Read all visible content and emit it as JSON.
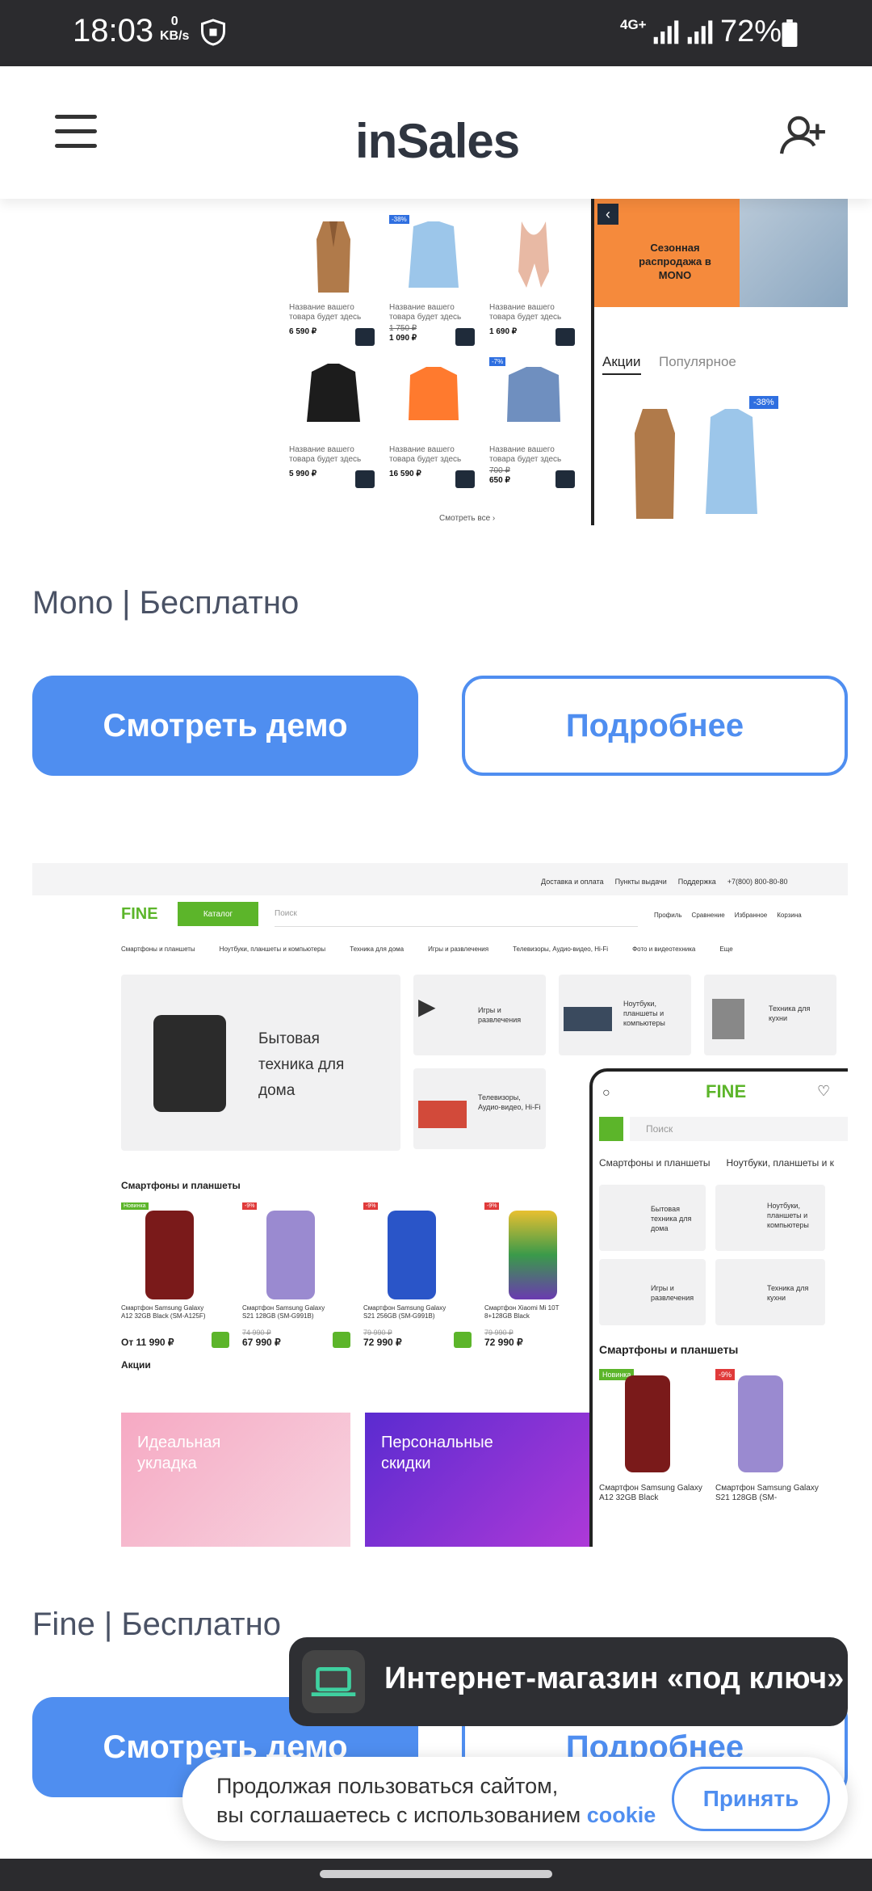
{
  "status": {
    "time": "18:03",
    "speed_value": "0",
    "speed_unit": "KB/s",
    "network": "4G+",
    "battery": "72%"
  },
  "header": {
    "logo_in": "in",
    "logo_sales": "Sales"
  },
  "mono": {
    "products": [
      {
        "name": "Название вашего товара будет здесь",
        "price": "6 590 ₽",
        "old": ""
      },
      {
        "name": "Название вашего товара будет здесь",
        "price": "1 090 ₽",
        "old": "1 750 ₽",
        "badge": "-38%"
      },
      {
        "name": "Название вашего товара будет здесь",
        "price": "1 690 ₽",
        "old": ""
      },
      {
        "name": "Название вашего товара будет здесь",
        "price": "5 990 ₽",
        "old": ""
      },
      {
        "name": "Название вашего товара будет здесь",
        "price": "16 590 ₽",
        "old": ""
      },
      {
        "name": "Название вашего товара будет здесь",
        "price": "650 ₽",
        "old": "700 ₽",
        "badge": "-7%"
      }
    ],
    "view_all": "Смотреть все  ›",
    "banner": "Сезонная распродажа в MONO",
    "tab_active": "Акции",
    "tab_other": "Популярное",
    "mobile_badge": "-38%",
    "caption": "Mono | Бесплатно",
    "demo_label": "Смотреть демо",
    "more_label": "Подробнее"
  },
  "fine": {
    "top_links": [
      "Доставка и оплата",
      "Пункты выдачи",
      "Поддержка",
      "+7(800) 800-80-80"
    ],
    "logo": "FINE",
    "catalog": "Каталог",
    "search_placeholder": "Поиск",
    "header_icons": [
      "Профиль",
      "Сравнение",
      "Избранное",
      "Корзина"
    ],
    "menu": [
      "Смартфоны и планшеты",
      "Ноутбуки, планшеты и компьютеры",
      "Техника для дома",
      "Игры и развлечения",
      "Телевизоры, Аудио-видео, Hi-Fi",
      "Фото и видеотехника",
      "Еще"
    ],
    "hero_tile": "Бытовая техника для дома",
    "small_tiles": [
      "Игры и развлечения",
      "Ноутбуки, планшеты и компьютеры",
      "Техника для кухни",
      "Телевизоры, Аудио-видео, Hi-Fi"
    ],
    "section_phones": "Смартфоны и планшеты",
    "phones": [
      {
        "name": "Смартфон Samsung Galaxy A12 32GB Black (SM-A125F)",
        "price": "От 11 990 ₽",
        "old": "",
        "badge": "Новинка"
      },
      {
        "name": "Смартфон Samsung Galaxy S21 128GB (SM-G991B)",
        "price": "67 990 ₽",
        "old": "74 990 ₽",
        "badge": "-9%"
      },
      {
        "name": "Смартфон Samsung Galaxy S21 256GB (SM-G991B)",
        "price": "72 990 ₽",
        "old": "79 990 ₽",
        "badge": "-9%"
      },
      {
        "name": "Смартфон Xiaomi Mi 10T 8+128GB Black",
        "price": "72 990 ₽",
        "old": "79 990 ₽",
        "badge": "-9%"
      }
    ],
    "section_promo": "Акции",
    "promo1": "Идеальная укладка",
    "promo2": "Персональные скидки",
    "mobile": {
      "logo": "FINE",
      "search": "Поиск",
      "menu": [
        "Смартфоны и планшеты",
        "Ноутбуки, планшеты и к"
      ],
      "tiles": [
        "Бытовая техника для дома",
        "Ноутбуки, планшеты и компьютеры",
        "Игры и развлечения",
        "Техника для кухни"
      ],
      "section": "Смартфоны и планшеты",
      "phones": [
        "Смартфон Samsung Galaxy A12 32GB Black",
        "Смартфон Samsung Galaxy S21 128GB (SM-"
      ],
      "badge_new": "Новинка",
      "badge_sale": "-9%"
    },
    "caption": "Fine | Бесплатно",
    "demo_label": "Смотреть демо",
    "more_label": "Подробнее"
  },
  "toast": {
    "text": "Интернет-магазин «под ключ»",
    "icon": "laptop-icon"
  },
  "cookie": {
    "line1": "Продолжая пользоваться сайтом,",
    "line2": "вы соглашаетесь с использованием",
    "link": "cookie",
    "accept": "Принять"
  },
  "colors": {
    "accent": "#4f8ef0",
    "fine_green": "#5cb52a",
    "mono_orange": "#f58a3c",
    "dark": "#2b2b2e"
  }
}
